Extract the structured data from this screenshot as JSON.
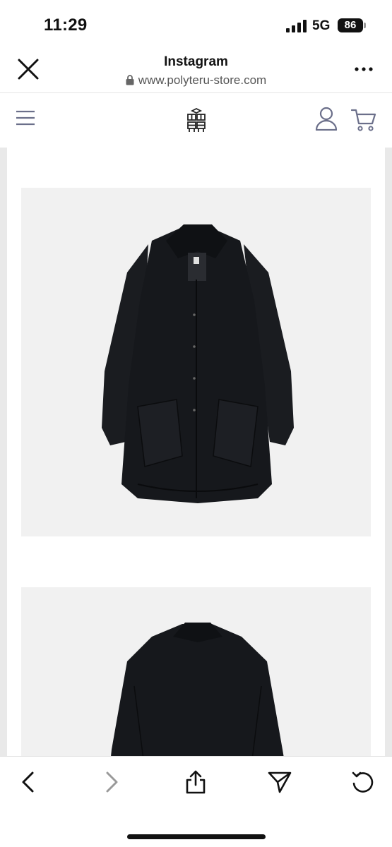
{
  "status_bar": {
    "time": "11:29",
    "network": "5G",
    "battery": "86"
  },
  "browser": {
    "title": "Instagram",
    "url": "www.polyteru-store.com"
  },
  "site": {
    "logo_icon": "polyteru-logo-icon"
  },
  "products": [
    {
      "image": "black-coat-front"
    },
    {
      "image": "black-coat-back"
    }
  ],
  "colors": {
    "nav_icons": "#6b6f8a",
    "image_bg": "#f1f1f1",
    "coat": "#16181c"
  }
}
